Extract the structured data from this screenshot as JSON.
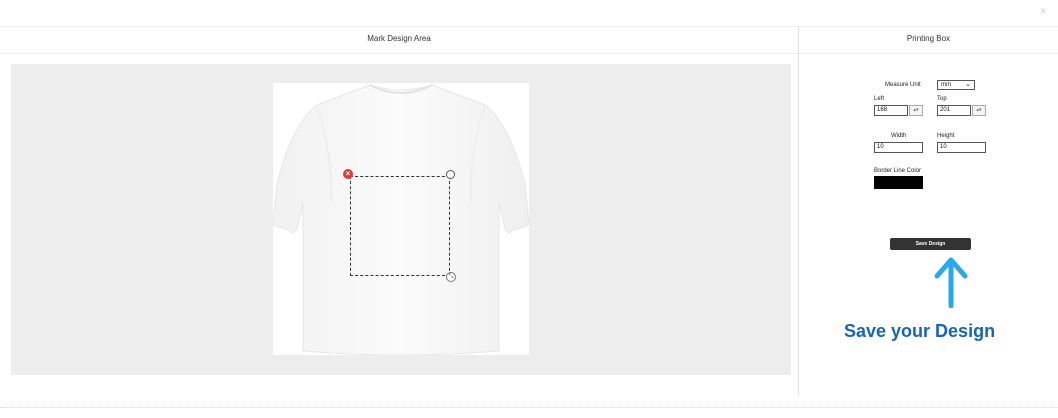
{
  "window": {
    "close_glyph": "×"
  },
  "design_area": {
    "title": "Mark Design Area"
  },
  "printing_box": {
    "title": "Printing Box",
    "measure_unit_label": "Measure Unit",
    "measure_unit_value": "mm",
    "left_label": "Left",
    "left_value": "168",
    "top_label": "Top",
    "top_value": "201",
    "width_label": "Width",
    "width_value": "10",
    "height_label": "Height",
    "height_value": "10",
    "border_color_label": "Border Line Color",
    "border_color": "#000000",
    "save_button_label": "Save Design"
  },
  "callout": {
    "text": "Save your Design",
    "color": "#1565b8",
    "arrow_color": "#29a8ec"
  },
  "icons": [
    "close-icon",
    "delete-icon",
    "rotate-icon",
    "resize-icon",
    "chevron-down-icon",
    "chevron-left-icon",
    "chevron-right-icon",
    "up-arrow-icon"
  ]
}
